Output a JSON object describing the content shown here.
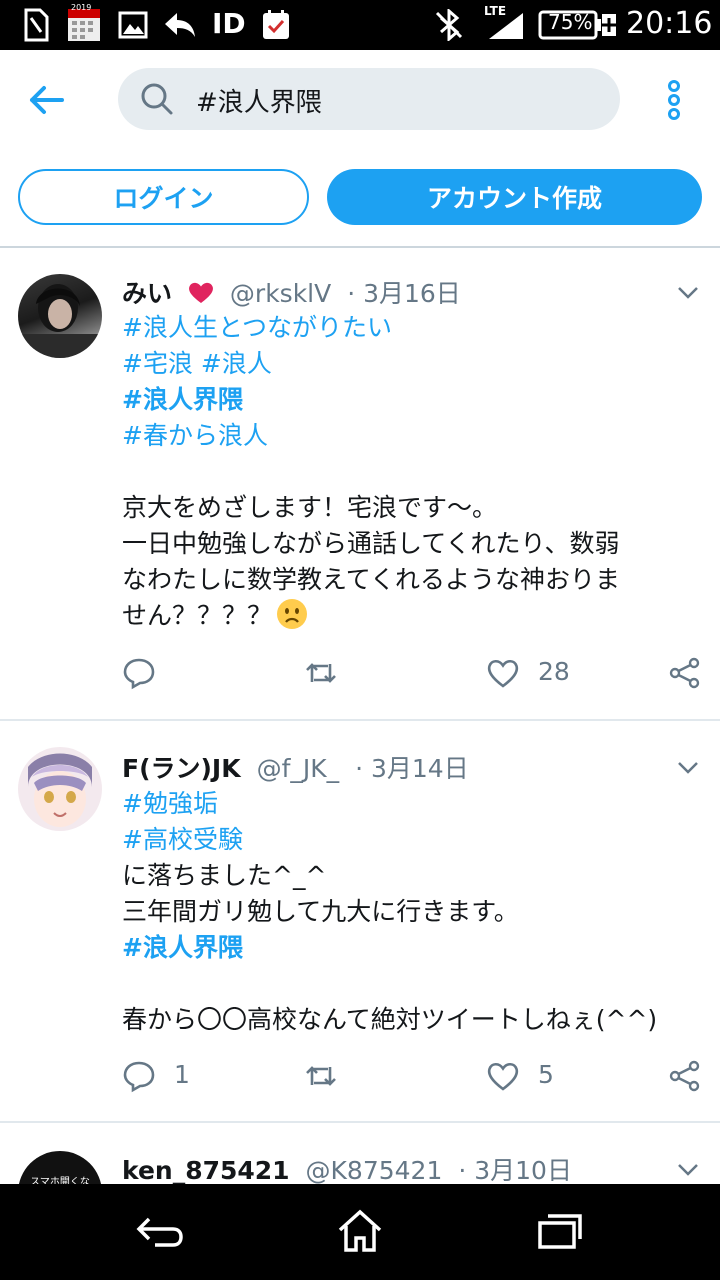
{
  "status_bar": {
    "id_label": "ID",
    "calendar_year": "2019",
    "network": "LTE",
    "battery": "75%",
    "time": "20:16"
  },
  "search": {
    "query": "#浪人界隈"
  },
  "auth": {
    "login_label": "ログイン",
    "signup_label": "アカウント作成"
  },
  "colors": {
    "accent": "#1da1f2",
    "heart": "#e0245e",
    "muted": "#657786"
  },
  "tweets": [
    {
      "name": "みい",
      "handle": "@rksklV",
      "date": "· 3月16日",
      "lines": [
        "#浪人生とつながりたい",
        "#宅浪",
        "#浪人",
        "#浪人界隈",
        "#春から浪人",
        "京大をめざします！宅浪です〜。",
        "一日中勉強しながら通話してくれたり、数弱",
        "なわたしに数学教えてくれるような神おりま",
        "せん？？？？"
      ],
      "reply_count": "",
      "like_count": "28"
    },
    {
      "name": "F(ラン)JK",
      "handle": "@f_JK_",
      "date": "· 3月14日",
      "lines": [
        "#勉強垢",
        "#高校受験",
        "に落ちました^_^",
        "三年間ガリ勉して九大に行きます。",
        "#浪人界隈",
        "春から〇〇高校なんて絶対ツイートしねぇ(^^)"
      ],
      "reply_count": "1",
      "like_count": "5"
    },
    {
      "name": "ken_875421",
      "handle": "@K875421",
      "date": "· 3月10日",
      "avatar_text": "スマホ開くな"
    }
  ]
}
